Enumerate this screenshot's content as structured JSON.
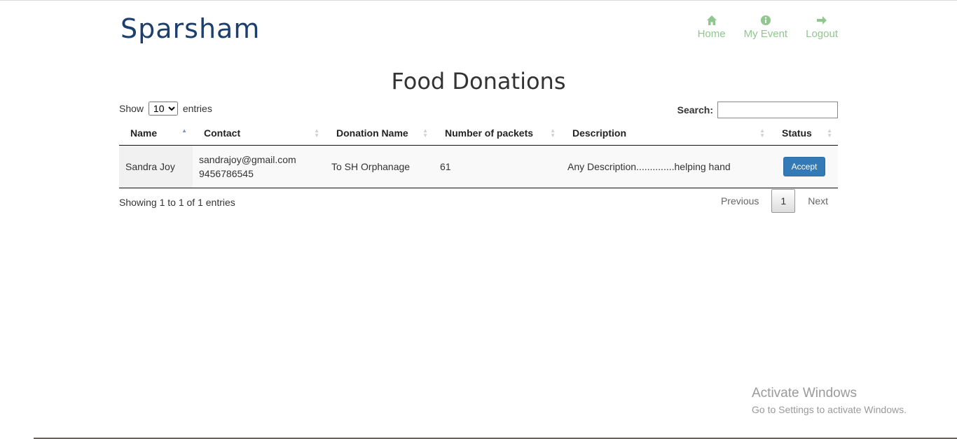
{
  "brand": "Sparsham",
  "nav": [
    {
      "label": "Home",
      "icon": "home-icon"
    },
    {
      "label": "My Event",
      "icon": "info-icon"
    },
    {
      "label": "Logout",
      "icon": "arrow-right-icon"
    }
  ],
  "page_title": "Food Donations",
  "length": {
    "prefix": "Show",
    "value": "10",
    "suffix": "entries"
  },
  "search": {
    "label": "Search:",
    "value": ""
  },
  "table": {
    "columns": [
      "Name",
      "Contact",
      "Donation Name",
      "Number of packets",
      "Description",
      "Status"
    ],
    "rows": [
      {
        "name": "Sandra Joy",
        "email": "sandrajoy@gmail.com",
        "phone": "9456786545",
        "donation": "To SH Orphanage",
        "packets": "61",
        "description": "Any Description..............helping hand",
        "status_button": "Accept"
      }
    ]
  },
  "info": "Showing 1 to 1 of 1 entries",
  "pagination": {
    "previous": "Previous",
    "current": "1",
    "next": "Next"
  },
  "watermark": {
    "line1": "Activate Windows",
    "line2": "Go to Settings to activate Windows."
  },
  "colors": {
    "brand": "#1d3f6e",
    "nav": "#8fc78f",
    "accept": "#337ab7"
  }
}
